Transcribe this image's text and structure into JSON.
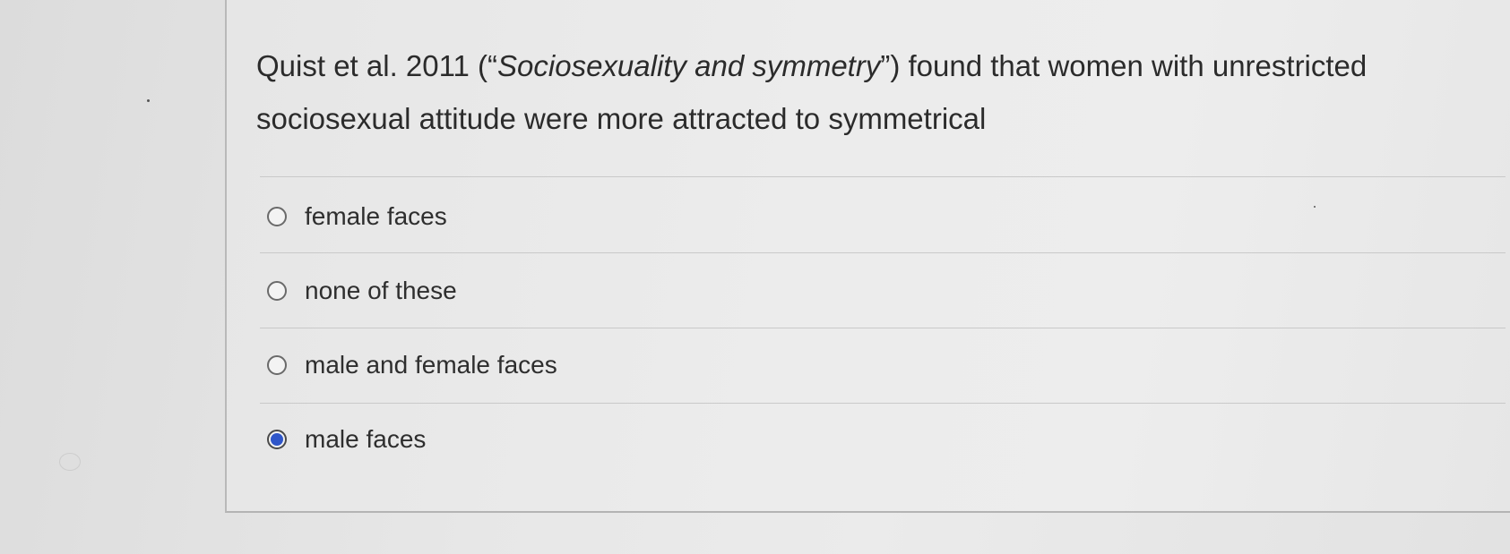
{
  "question": {
    "prefix": "Quist et al. 2011 (“",
    "italic": "Sociosexuality and symmetry",
    "suffix": "”) found that women with unrestricted sociosexual attitude were more attracted to symmetrical"
  },
  "options": [
    {
      "label": "female faces",
      "selected": false
    },
    {
      "label": "none of these",
      "selected": false
    },
    {
      "label": "male and female faces",
      "selected": false
    },
    {
      "label": "male faces",
      "selected": true
    }
  ],
  "colors": {
    "selected_radio": "#2f56c9",
    "text": "#2e2e2e",
    "background": "#e8e8e8"
  }
}
